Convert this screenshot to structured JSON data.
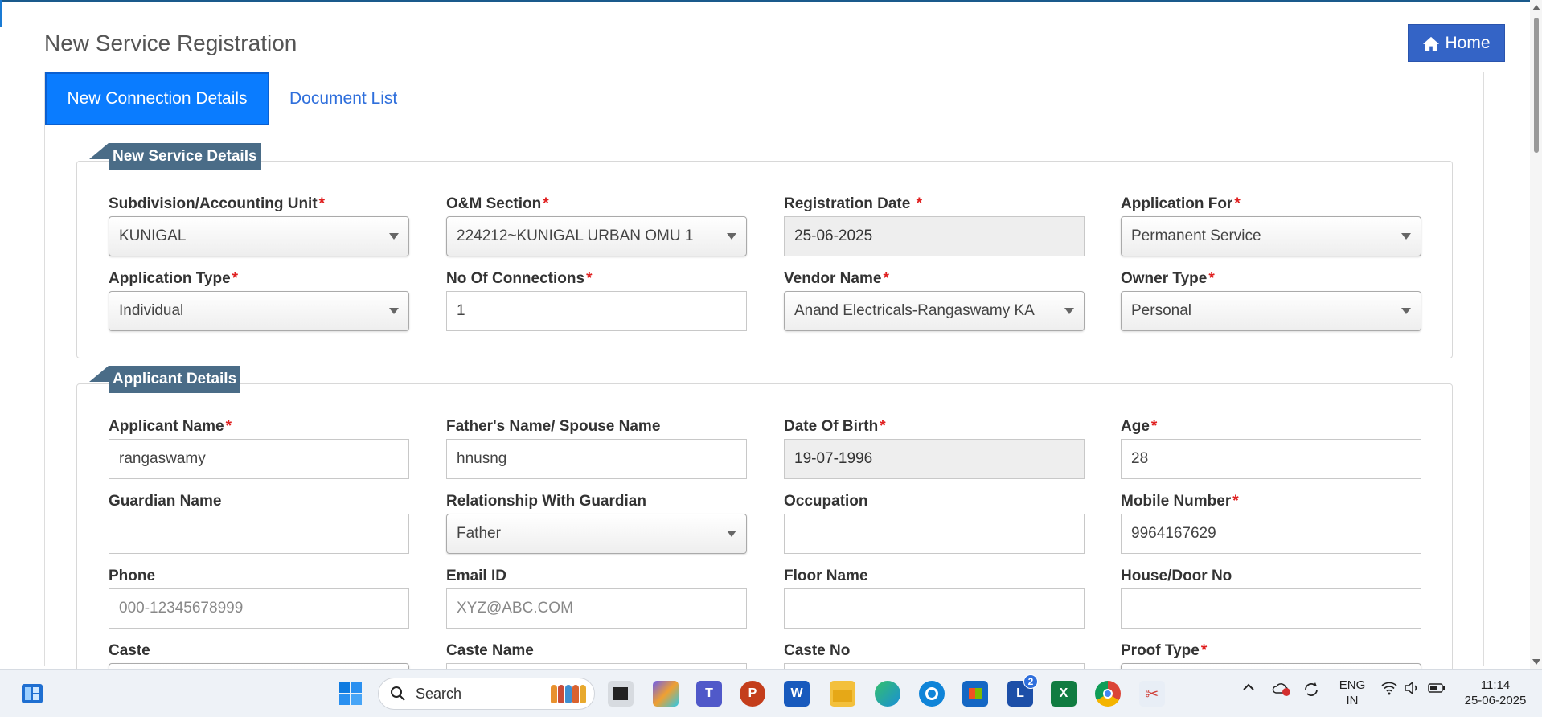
{
  "page": {
    "title": "New Service Registration",
    "home_label": "Home"
  },
  "tabs": [
    {
      "label": "New Connection Details"
    },
    {
      "label": "Document List"
    }
  ],
  "new_service": {
    "legend": "New Service Details",
    "subdivision": {
      "label": "Subdivision/Accounting Unit",
      "required": "*",
      "value": "KUNIGAL"
    },
    "om_section": {
      "label": "O&M Section",
      "required": "*",
      "value": "224212~KUNIGAL URBAN OMU 1"
    },
    "registration_date": {
      "label": "Registration Date",
      "required": "*",
      "value": "25-06-2025"
    },
    "application_for": {
      "label": "Application For",
      "required": "*",
      "value": "Permanent Service"
    },
    "application_type": {
      "label": "Application Type",
      "required": "*",
      "value": "Individual"
    },
    "no_of_connections": {
      "label": "No Of Connections",
      "required": "*",
      "value": "1"
    },
    "vendor_name": {
      "label": "Vendor Name",
      "required": "*",
      "value": "Anand Electricals-Rangaswamy KA"
    },
    "owner_type": {
      "label": "Owner Type",
      "required": "*",
      "value": "Personal"
    }
  },
  "applicant": {
    "legend": "Applicant Details",
    "applicant_name": {
      "label": "Applicant Name",
      "required": "*",
      "value": "rangaswamy"
    },
    "father_name": {
      "label": "Father's Name/ Spouse Name",
      "value": "hnusng"
    },
    "dob": {
      "label": "Date Of Birth",
      "required": "*",
      "value": "19-07-1996"
    },
    "age": {
      "label": "Age",
      "required": "*",
      "value": "28"
    },
    "guardian_name": {
      "label": "Guardian Name",
      "value": ""
    },
    "relationship": {
      "label": "Relationship With Guardian",
      "value": "Father"
    },
    "occupation": {
      "label": "Occupation",
      "value": ""
    },
    "mobile": {
      "label": "Mobile Number",
      "required": "*",
      "value": "9964167629"
    },
    "phone": {
      "label": "Phone",
      "placeholder": "000-12345678999"
    },
    "email": {
      "label": "Email ID",
      "placeholder": "XYZ@ABC.COM"
    },
    "floor_name": {
      "label": "Floor Name",
      "value": ""
    },
    "house_no": {
      "label": "House/Door No",
      "value": ""
    },
    "caste": {
      "label": "Caste"
    },
    "caste_name": {
      "label": "Caste Name"
    },
    "caste_no": {
      "label": "Caste No"
    },
    "proof_type": {
      "label": "Proof Type",
      "required": "*"
    }
  },
  "taskbar": {
    "search_label": "Search",
    "badge_count": "2",
    "lang_top": "ENG",
    "lang_bottom": "IN",
    "time": "11:14",
    "date": "25-06-2025"
  },
  "colors": {
    "primary_tab": "#0a7cff",
    "home_button": "#3464c6",
    "legend_bg": "#4a6c87",
    "required": "#e02020"
  }
}
